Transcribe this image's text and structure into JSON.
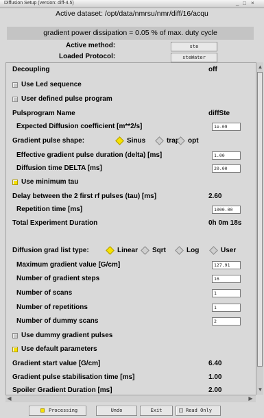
{
  "window": {
    "title": "Diffusion Setup (version: diff-4.5)",
    "controls": "_ □ ×"
  },
  "header": {
    "active_dataset": "Active dataset: /opt/data/nmrsu/nmr/diff/16/acqu",
    "gradient_power": "gradient power dissipation = 0.05 % of max. duty cycle",
    "active_method_label": "Active method:",
    "active_method_value": "ste",
    "loaded_protocol_label": "Loaded Protocol:",
    "loaded_protocol_value": "steWater"
  },
  "form": {
    "decoupling_label": "Decoupling",
    "decoupling_value": "off",
    "use_led_label": "Use Led sequence",
    "user_defined_label": "User defined pulse program",
    "pulseprogram_label": "Pulsprogram Name",
    "pulseprogram_value": "diffSte",
    "expected_diff_label": "Expected Diffusion coefficient [m**2/s]",
    "expected_diff_value": "1e-09",
    "gradient_shape_label": "Gradient pulse shape:",
    "shape_sinus": "Sinus",
    "shape_trap": "trap",
    "shape_opt": "opt",
    "eff_delta_label": "Effective gradient pulse duration (delta) [ms]",
    "eff_delta_value": "1.00",
    "diff_time_label": "Diffusion time DELTA [ms]",
    "diff_time_value": "20.00",
    "use_min_tau_label": "Use minimum tau",
    "delay_tau_label": "Delay between the 2 first rf pulses (tau) [ms]",
    "delay_tau_value": "2.60",
    "rep_time_label": "Repetition time [ms]",
    "rep_time_value": "1000.00",
    "total_duration_label": "Total Experiment Duration",
    "total_duration_value": "0h 0m 18s",
    "grad_list_label": "Diffusion grad list type:",
    "list_linear": "Linear",
    "list_sqrt": "Sqrt",
    "list_log": "Log",
    "list_user": "User",
    "max_grad_label": "Maximum gradient value [G/cm]",
    "max_grad_value": "127.91",
    "num_steps_label": "Number of gradient steps",
    "num_steps_value": "16",
    "num_scans_label": "Number of scans",
    "num_scans_value": "1",
    "num_reps_label": "Number of repetitions",
    "num_reps_value": "1",
    "num_dummy_label": "Number of dummy scans",
    "num_dummy_value": "2",
    "use_dummy_grad_label": "Use dummy gradient pulses",
    "use_default_label": "Use default parameters",
    "grad_start_label": "Gradient start value [G/cm]",
    "grad_start_value": "6.40",
    "grad_stab_label": "Gradient pulse stabilisation time [ms]",
    "grad_stab_value": "1.00",
    "spoiler_label": "Spoiler Gradient Duration [ms]",
    "spoiler_value": "2.00"
  },
  "footer": {
    "processing": "Processing",
    "undo": "Undo",
    "exit": "Exit",
    "read_only": "Read Only"
  },
  "colors": {
    "accent": "#f6e200",
    "background": "#d9d9d9"
  }
}
